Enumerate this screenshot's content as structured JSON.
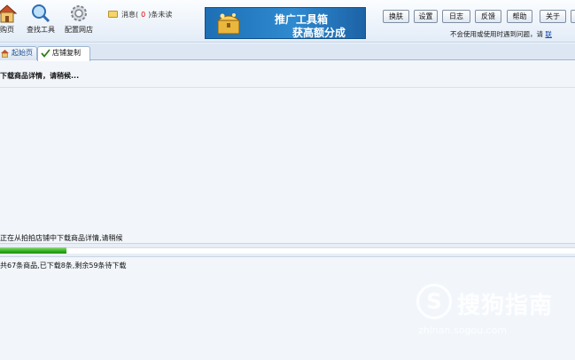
{
  "toolbar": {
    "buttons": [
      {
        "label": "",
        "icon": "home-icon"
      },
      {
        "label": "查找工具",
        "icon": "magnifier-icon"
      },
      {
        "label": "配置网店",
        "icon": "gear-icon"
      }
    ],
    "home_label_partial": "购页"
  },
  "messages": {
    "prefix": "消息(",
    "count": "0",
    "suffix": ")条未读"
  },
  "banner": {
    "line1": "推广工具箱",
    "line2": "获高额分成"
  },
  "top_buttons": [
    "换肤",
    "设置",
    "日志",
    "反馈",
    "帮助",
    "关于"
  ],
  "notice": {
    "text": "不会使用或使用时遇到问题，请",
    "link": "联"
  },
  "tabs": [
    {
      "label": "起始页",
      "icon": "home-icon",
      "active": false
    },
    {
      "label": "店铺复制",
      "icon": "checkmark-icon",
      "active": true
    }
  ],
  "content": {
    "loading_text": "下载商品详情，请稍候...",
    "status_line": "正在从拍拍店铺中下载商品详情,请稍候",
    "progress_fraction": 0.115,
    "summary_line": "共67条商品,已下载8条,剩余59条待下载"
  },
  "watermark": {
    "logo_letter": "S",
    "title": "搜狗指南",
    "url": "zhinan.sogou.com"
  },
  "colors": {
    "accent": "#1d6fb4",
    "progress": "#2fae1d",
    "unread_count": "#dd0000"
  }
}
